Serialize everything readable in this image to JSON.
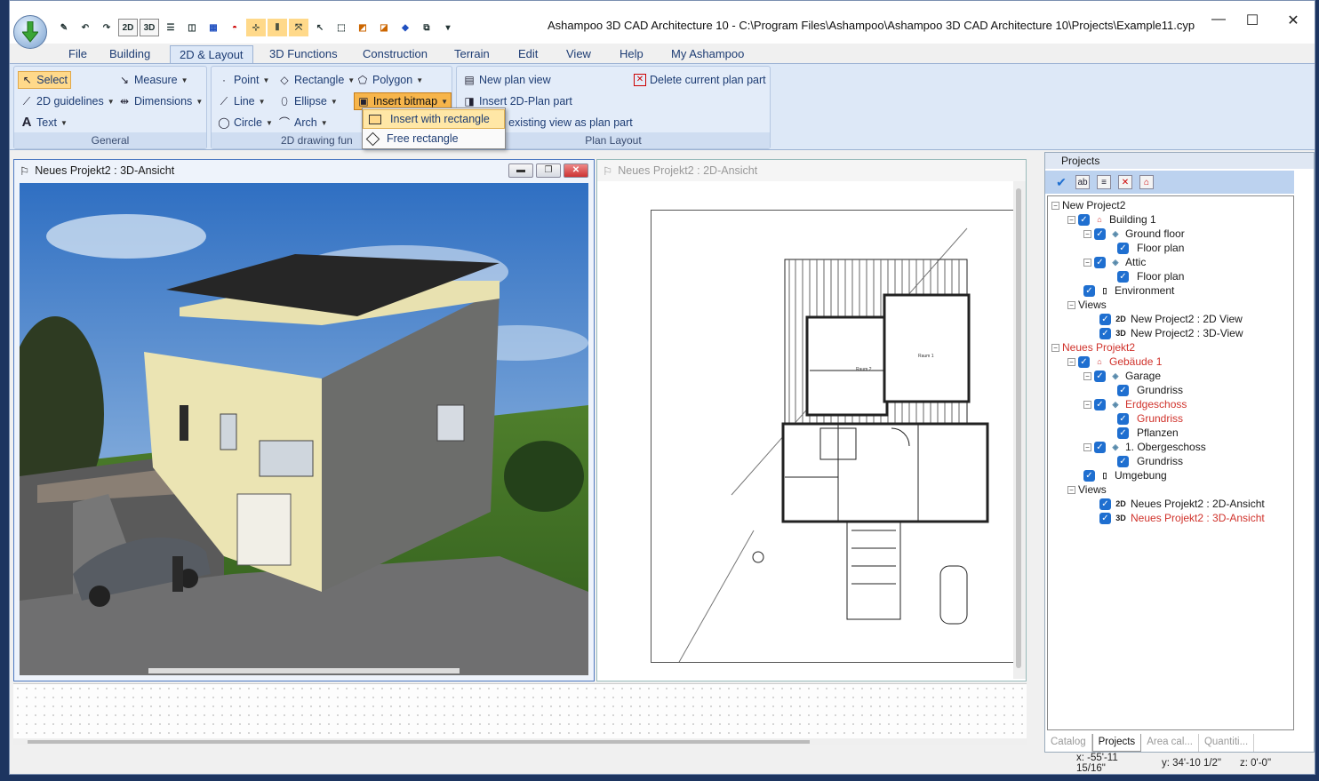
{
  "window": {
    "title": "Ashampoo 3D CAD Architecture 10 - C:\\Program Files\\Ashampoo\\Ashampoo 3D CAD Architecture 10\\Projects\\Example11.cyp",
    "min": "—",
    "max": "☐",
    "close": "✕"
  },
  "qat": [
    "✎",
    "↶",
    "↷",
    "2D",
    "3D",
    "☰",
    "◫",
    "▦",
    "◓",
    "⊹",
    "⫴",
    "⤧",
    "↖",
    "⬚",
    "◩",
    "◪",
    "◆",
    "⧉",
    "▾"
  ],
  "tabs": [
    {
      "label": "File"
    },
    {
      "label": "Building"
    },
    {
      "label": "2D & Layout"
    },
    {
      "label": "3D Functions"
    },
    {
      "label": "Construction"
    },
    {
      "label": "Terrain"
    },
    {
      "label": "Edit"
    },
    {
      "label": "View"
    },
    {
      "label": "Help"
    },
    {
      "label": "My Ashampoo"
    }
  ],
  "ribbon": {
    "general": {
      "label": "General",
      "select": "Select",
      "measure": "Measure",
      "guidelines": "2D guidelines",
      "dimensions": "Dimensions",
      "text": "Text"
    },
    "drawing": {
      "label": "2D drawing fun",
      "point": "Point",
      "rectangle": "Rectangle",
      "polygon": "Polygon",
      "line": "Line",
      "ellipse": "Ellipse",
      "insert_bitmap": "Insert bitmap",
      "circle": "Circle",
      "arch": "Arch"
    },
    "plan": {
      "label": "Plan Layout",
      "new_plan": "New plan view",
      "insert_2d": "Insert 2D-Plan part",
      "insert_existing": "rt existing view as plan part",
      "delete": "Delete current plan part"
    }
  },
  "dropdown": {
    "insert_rect": "Insert with rectangle",
    "free_rect": "Free rectangle"
  },
  "viewport3d": {
    "title": "Neues Projekt2 : 3D-Ansicht"
  },
  "viewport2d": {
    "title": "Neues Projekt2 : 2D-Ansicht"
  },
  "projects": {
    "title": "Projects",
    "tree": [
      {
        "label": "New Project2"
      },
      {
        "label": "Building 1"
      },
      {
        "label": "Ground floor"
      },
      {
        "label": "Floor plan"
      },
      {
        "label": "Attic"
      },
      {
        "label": "Floor plan"
      },
      {
        "label": "Environment"
      },
      {
        "label": "Views"
      },
      {
        "label": "New Project2 : 2D View"
      },
      {
        "label": "New Project2 : 3D-View"
      },
      {
        "label": "Neues Projekt2"
      },
      {
        "label": "Gebäude 1"
      },
      {
        "label": "Garage"
      },
      {
        "label": "Grundriss"
      },
      {
        "label": "Erdgeschoss"
      },
      {
        "label": "Grundriss"
      },
      {
        "label": "Pflanzen"
      },
      {
        "label": "1. Obergeschoss"
      },
      {
        "label": "Grundriss"
      },
      {
        "label": "Umgebung"
      },
      {
        "label": "Views"
      },
      {
        "label": "Neues Projekt2 : 2D-Ansicht"
      },
      {
        "label": "Neues Projekt2 : 3D-Ansicht"
      }
    ],
    "bottom_tabs": [
      "Catalog",
      "Projects",
      "Area cal...",
      "Quantiti..."
    ]
  },
  "status": {
    "x": "x: -55'-11",
    "x2": "15/16\"",
    "y": "y: 34'-10 1/2\"",
    "z": "z: 0'-0\""
  },
  "colors": {
    "accent": "#1f6fd0",
    "red_item": "#d0322b",
    "ribbon_bg": "#dde8f7",
    "highlight": "#f7b54b"
  }
}
